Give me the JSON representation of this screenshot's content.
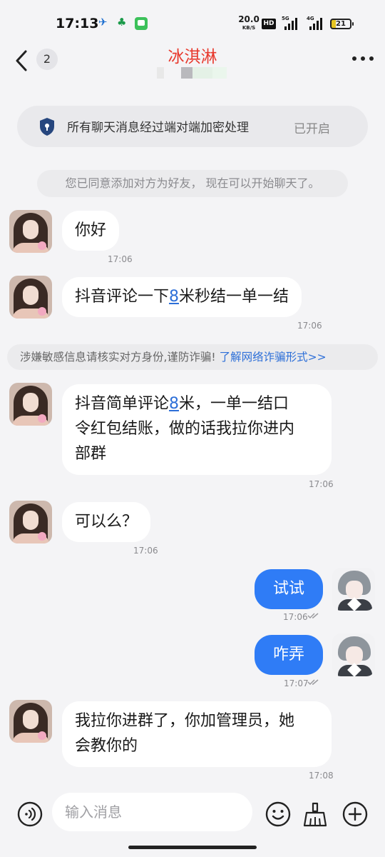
{
  "status_bar": {
    "time": "17:13",
    "net_speed": "20.0",
    "net_unit": "KB/S",
    "hd": "HD",
    "sig1_tag": "5G",
    "sig2_tag": "4G",
    "battery": "21"
  },
  "header": {
    "unread_count": "2",
    "title": "冰淇淋",
    "title_color": "#e8392d"
  },
  "encryption": {
    "text": "所有聊天消息经过端对端加密处理",
    "status": "已开启"
  },
  "system_notice": "您已同意添加对方为好友， 现在可以开始聊天了。",
  "warning": {
    "text": "涉嫌敏感信息请核实对方身份,谨防诈骗!",
    "link": "了解网络诈骗形式>>"
  },
  "messages": [
    {
      "from": "them",
      "text": "你好",
      "time": "17:06"
    },
    {
      "from": "them",
      "pre": "抖音评论一下",
      "hl": "8",
      "post": "米秒结一单一结",
      "time": "17:06"
    },
    {
      "from": "them",
      "line1_pre": "抖音简单评论",
      "line1_hl": "8",
      "line1_post": "米，一单一结口",
      "line2": "令红包结账，做的话我拉你进内",
      "line3": "部群",
      "time": "17:06"
    },
    {
      "from": "them",
      "text": "可以么？",
      "time": "17:06"
    },
    {
      "from": "me",
      "text": "试试",
      "time": "17:06"
    },
    {
      "from": "me",
      "text": "咋弄",
      "time": "17:07"
    },
    {
      "from": "them",
      "line1": "我拉你进群了，你加管理员，她",
      "line2": "会教你的",
      "time": "17:08"
    }
  ],
  "input": {
    "placeholder": "输入消息"
  },
  "icons": {
    "back": "chevron-left-icon",
    "more": "more-dots-icon",
    "shield": "shield-lock-icon",
    "voice": "voice-icon",
    "emoji": "emoji-icon",
    "broom": "broom-icon",
    "plus": "plus-icon"
  },
  "colors": {
    "accent": "#2f7cf6",
    "link": "#2d6fd8",
    "background": "#f4f4f6"
  }
}
